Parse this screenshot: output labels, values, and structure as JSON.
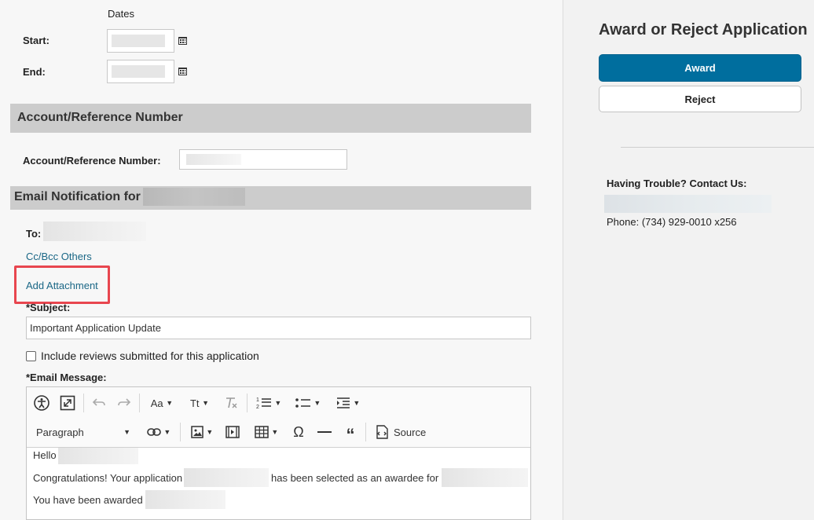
{
  "dates": {
    "title": "Dates",
    "start_label": "Start:",
    "end_label": "End:"
  },
  "account_section": {
    "header": "Account/Reference Number",
    "field_label": "Account/Reference Number:"
  },
  "email_section": {
    "header": "Email Notification for",
    "to_label": "To:",
    "cc_link": "Cc/Bcc Others",
    "attachment_link": "Add Attachment",
    "subject_label": "*Subject:",
    "subject_value": "Important Application Update",
    "include_reviews_label": "Include reviews submitted for this application",
    "message_label": "*Email Message:"
  },
  "editor": {
    "paragraph_select": "Paragraph",
    "source_label": "Source",
    "font_size_label": "Aa",
    "text_transform_label": "Tt",
    "body_lines": {
      "hello": "Hello",
      "congrats_a": "Congratulations! Your application",
      "congrats_b": "has been selected as an awardee for",
      "awarded": "You have been awarded"
    }
  },
  "sidebar": {
    "title": "Award or Reject Application",
    "award_button": "Award",
    "reject_button": "Reject",
    "trouble_heading": "Having Trouble? Contact Us:",
    "phone": "Phone: (734) 929-0010 x256"
  },
  "colors": {
    "primary": "#006e9e",
    "link": "#1a6786",
    "highlight": "#e8464f",
    "section_bar": "#cccccc"
  }
}
